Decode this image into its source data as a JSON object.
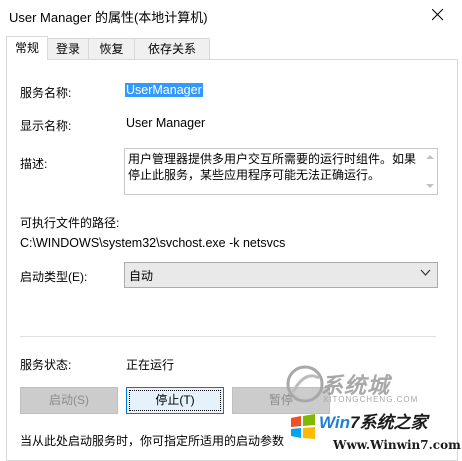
{
  "window": {
    "title": "User Manager 的属性(本地计算机)"
  },
  "tabs": [
    {
      "label": "常规",
      "active": true
    },
    {
      "label": "登录",
      "active": false
    },
    {
      "label": "恢复",
      "active": false
    },
    {
      "label": "依存关系",
      "active": false
    }
  ],
  "general": {
    "service_name_label": "服务名称:",
    "service_name_value": "UserManager",
    "display_name_label": "显示名称:",
    "display_name_value": "User Manager",
    "description_label": "描述:",
    "description_value": "用户管理器提供多用户交互所需要的运行时组件。如果停止此服务，某些应用程序可能无法正确运行。",
    "path_label": "可执行文件的路径:",
    "path_value": "C:\\WINDOWS\\system32\\svchost.exe -k netsvcs",
    "startup_type_label": "启动类型(E):",
    "startup_type_value": "自动",
    "status_label": "服务状态:",
    "status_value": "正在运行"
  },
  "buttons": {
    "start": "启动(S)",
    "stop": "停止(T)",
    "pause": "暂停"
  },
  "footer": {
    "hint": "当从此处启动服务时，你可指定所适用的启动参数"
  },
  "watermark": {
    "logo_text": "系统城",
    "logo_sub": "XITONGCHENG.COM",
    "brand_prefix": "Win",
    "brand_suffix": "7系统之家",
    "url": "Www.Winwin7.com"
  },
  "colors": {
    "selection": "#3399ff",
    "accent": "#0078d7"
  },
  "icons": {
    "close": "close-icon",
    "dropdown": "chevron-down-icon"
  }
}
